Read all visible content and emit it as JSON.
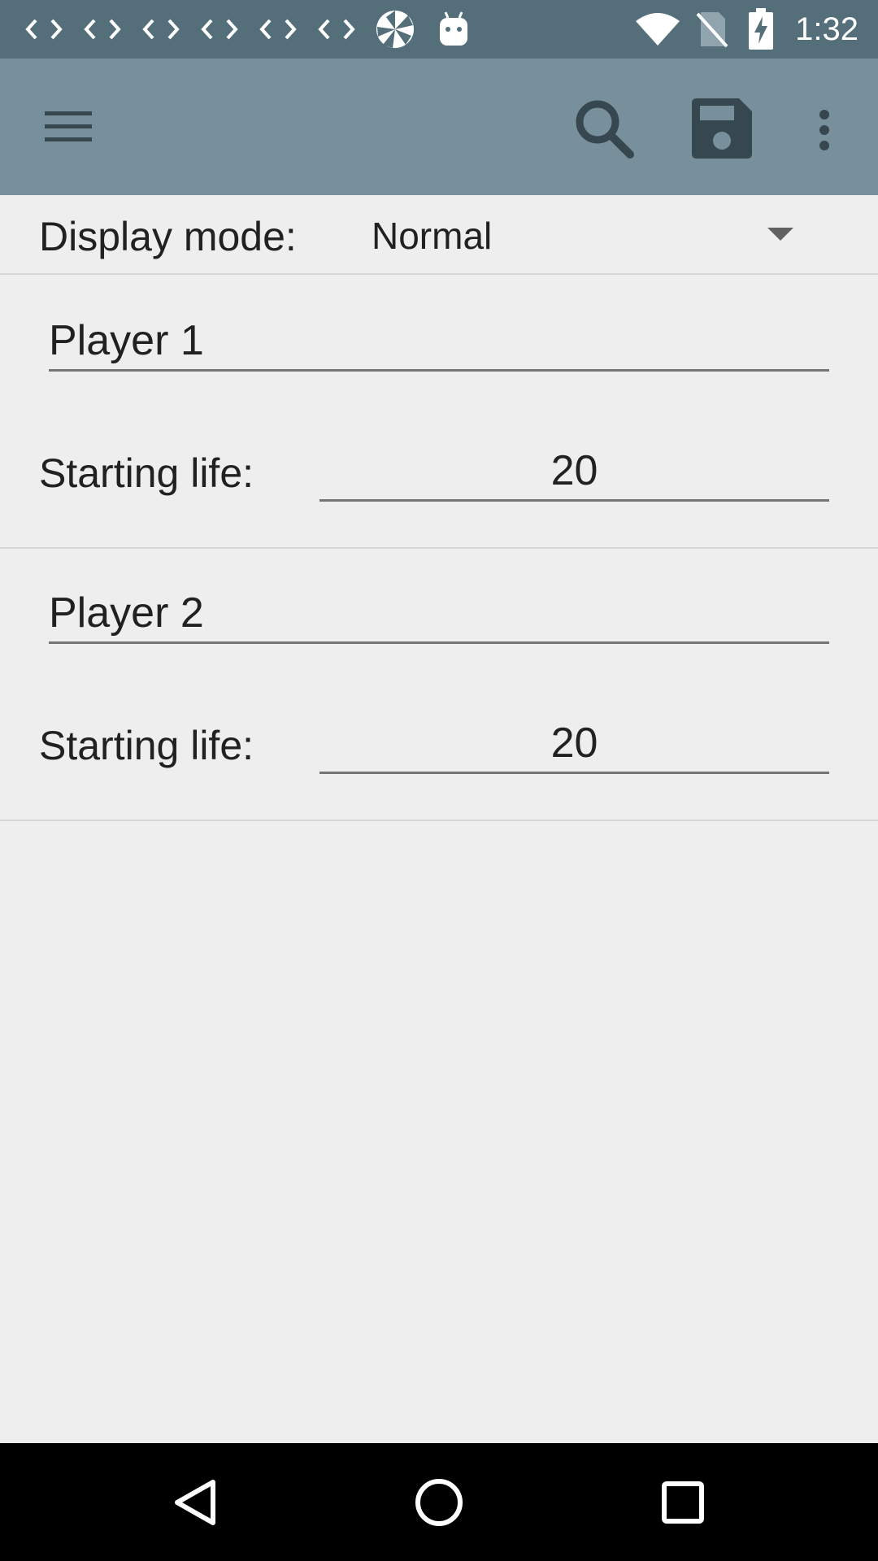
{
  "status_bar": {
    "time": "1:32",
    "notification_icons": [
      "code-icon",
      "code-icon",
      "code-icon",
      "code-icon",
      "code-icon",
      "code-icon",
      "pinwheel-icon",
      "android-icon"
    ],
    "system_icons": [
      "wifi-icon",
      "no-sim-icon",
      "battery-charging-icon"
    ],
    "background_color": "#546e7a"
  },
  "toolbar": {
    "background_color": "#78909c",
    "icons": [
      "menu-icon",
      "search-icon",
      "save-icon",
      "more-vert-icon"
    ]
  },
  "display_mode": {
    "label": "Display mode:",
    "value": "Normal"
  },
  "players": [
    {
      "name": "Player 1",
      "life_label": "Starting life:",
      "life_value": "20"
    },
    {
      "name": "Player 2",
      "life_label": "Starting life:",
      "life_value": "20"
    }
  ],
  "nav_bar": {
    "icons": [
      "back-icon",
      "home-icon",
      "recents-icon"
    ]
  }
}
